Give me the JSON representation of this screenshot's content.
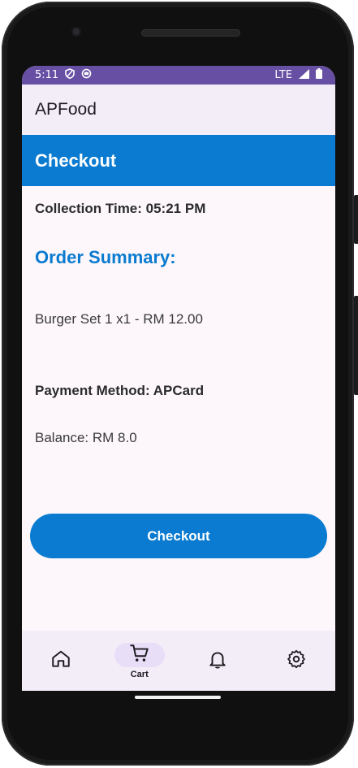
{
  "status_bar": {
    "time": "5:11",
    "network": "LTE"
  },
  "app_bar": {
    "title": "APFood"
  },
  "banner": {
    "title": "Checkout"
  },
  "content": {
    "collection_time": "Collection Time: 05:21 PM",
    "order_summary_heading": "Order Summary:",
    "items": [
      "Burger Set 1 x1 - RM 12.00"
    ],
    "payment_method": "Payment Method: APCard",
    "balance": "Balance: RM 8.0",
    "checkout_button": "Checkout"
  },
  "bottom_nav": {
    "items": [
      {
        "icon": "home-icon",
        "label": "",
        "active": false
      },
      {
        "icon": "cart-icon",
        "label": "Cart",
        "active": true
      },
      {
        "icon": "bell-icon",
        "label": "",
        "active": false
      },
      {
        "icon": "gear-icon",
        "label": "",
        "active": false
      }
    ]
  },
  "colors": {
    "accent": "#0a7bd0",
    "status_bar": "#6750a4",
    "app_bar": "#f3edf7"
  }
}
